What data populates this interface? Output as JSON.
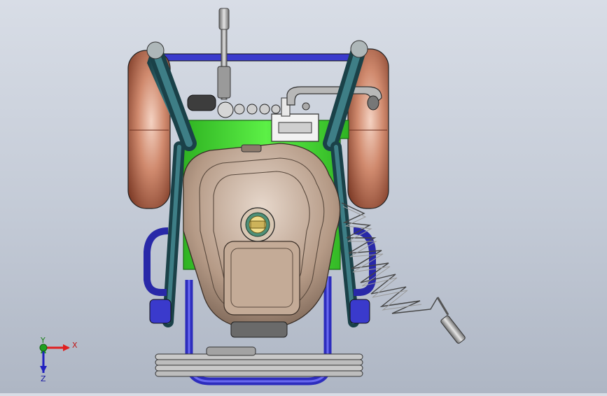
{
  "view": {
    "type": "CAD model viewport (top view)",
    "background_colors": [
      "#d8dde6",
      "#aeb6c4"
    ]
  },
  "triad": {
    "x_label": "X",
    "y_label": "Y",
    "z_label": "Z",
    "x_color": "#e02020",
    "y_color": "#20a020",
    "z_color": "#2020c0"
  },
  "model": {
    "frame_color": "#2a5b63",
    "wheel_color": "#c9826a",
    "base_color": "#4fe33a",
    "tank_color": "#b69a84",
    "guard_color": "#3a3acc"
  }
}
